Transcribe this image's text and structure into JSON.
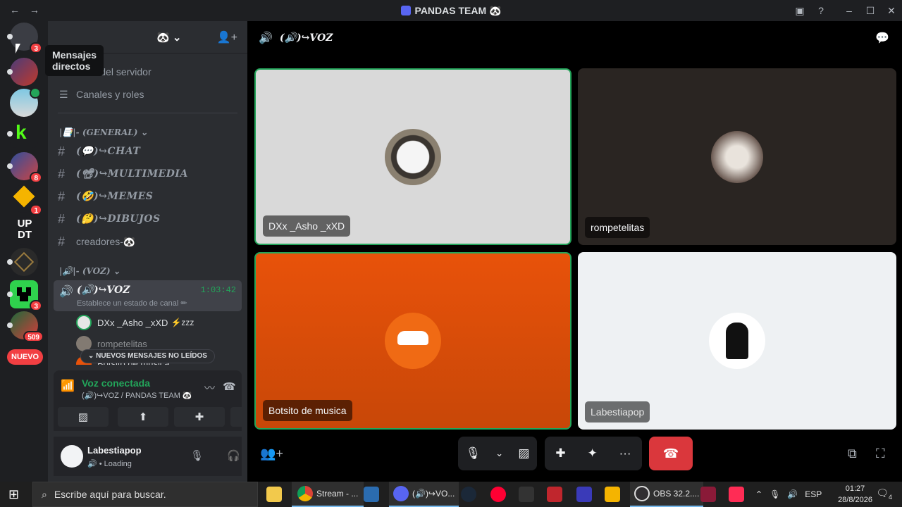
{
  "window": {
    "title": "PANDAS TEAM 🐼",
    "back": "←",
    "forward": "→",
    "inbox_icon": "inbox-icon",
    "help": "?",
    "minimize": "–",
    "maximize": "☐",
    "close": "✕"
  },
  "rail": {
    "tooltip": "Mensajes directos",
    "dm_badge": "3",
    "badges": [
      "8",
      "1",
      "3",
      "509"
    ],
    "nuevo_label": "NUEVO",
    "udt_label": "UP DT",
    "colors": {
      "accent": "#5865f2",
      "badge": "#f23f42",
      "green": "#23a55a"
    }
  },
  "sidebar": {
    "server_name": "🐼",
    "nav": [
      {
        "label": "Guía del servidor",
        "icon": "signpost-icon"
      },
      {
        "label": "Canales y roles",
        "icon": "channels-icon"
      }
    ],
    "category_general": "|📑|- (GENERAL)",
    "channels": [
      {
        "label": "(💬)↪CHAT"
      },
      {
        "label": "(📽)↪MULTIMEDIA"
      },
      {
        "label": "(🤣)↪MEMES"
      },
      {
        "label": "(🤔)↪DIBUJOS"
      },
      {
        "label": "creadores-🐼"
      }
    ],
    "category_voz": "|🔊|- (VOZ)",
    "voice_channel": {
      "name": "(🔊)↪VOZ",
      "elapsed": "1:03:42",
      "status": "Establece un estado de canal ✏"
    },
    "members": [
      {
        "name": "DXx _Asho _xXD",
        "extra": "⚡zzz"
      },
      {
        "name": "rompetelitas",
        "extra": ""
      },
      {
        "name": "Botsito de musica",
        "extra": ""
      }
    ],
    "unread_label": "NUEVOS MENSAJES NO LEÍDOS",
    "voice_connected": {
      "title": "Voz conectada",
      "subtitle": "(🔊)↪VOZ / PANDAS TEAM 🐼"
    },
    "user": {
      "name": "Labestiapop",
      "status": "Loading"
    }
  },
  "main": {
    "channel_name": "(🔊)↪VOZ",
    "tiles": [
      {
        "label": "DXx _Asho _xXD",
        "bg": "#d9d9d9",
        "border": "#23a55a"
      },
      {
        "label": "rompetelitas",
        "bg": "#2a2522",
        "border": ""
      },
      {
        "label": "Botsito de musica",
        "bg": "#e8520a",
        "border": "#23a55a"
      },
      {
        "label": "Labestiapop",
        "bg": "#eef1f3",
        "border": ""
      }
    ],
    "more": "···"
  },
  "taskbar": {
    "search_placeholder": "Escribe aquí para buscar.",
    "items": [
      {
        "label": "Stream - ...",
        "color": "#db4437"
      },
      {
        "label": "(🔊)↪VO...",
        "color": "#5865f2"
      },
      {
        "label": "OBS 32.2....",
        "color": "#302e31"
      }
    ],
    "lang": "ESP",
    "time": "01:27",
    "date": "28/8/2026",
    "notif_count": "4"
  }
}
